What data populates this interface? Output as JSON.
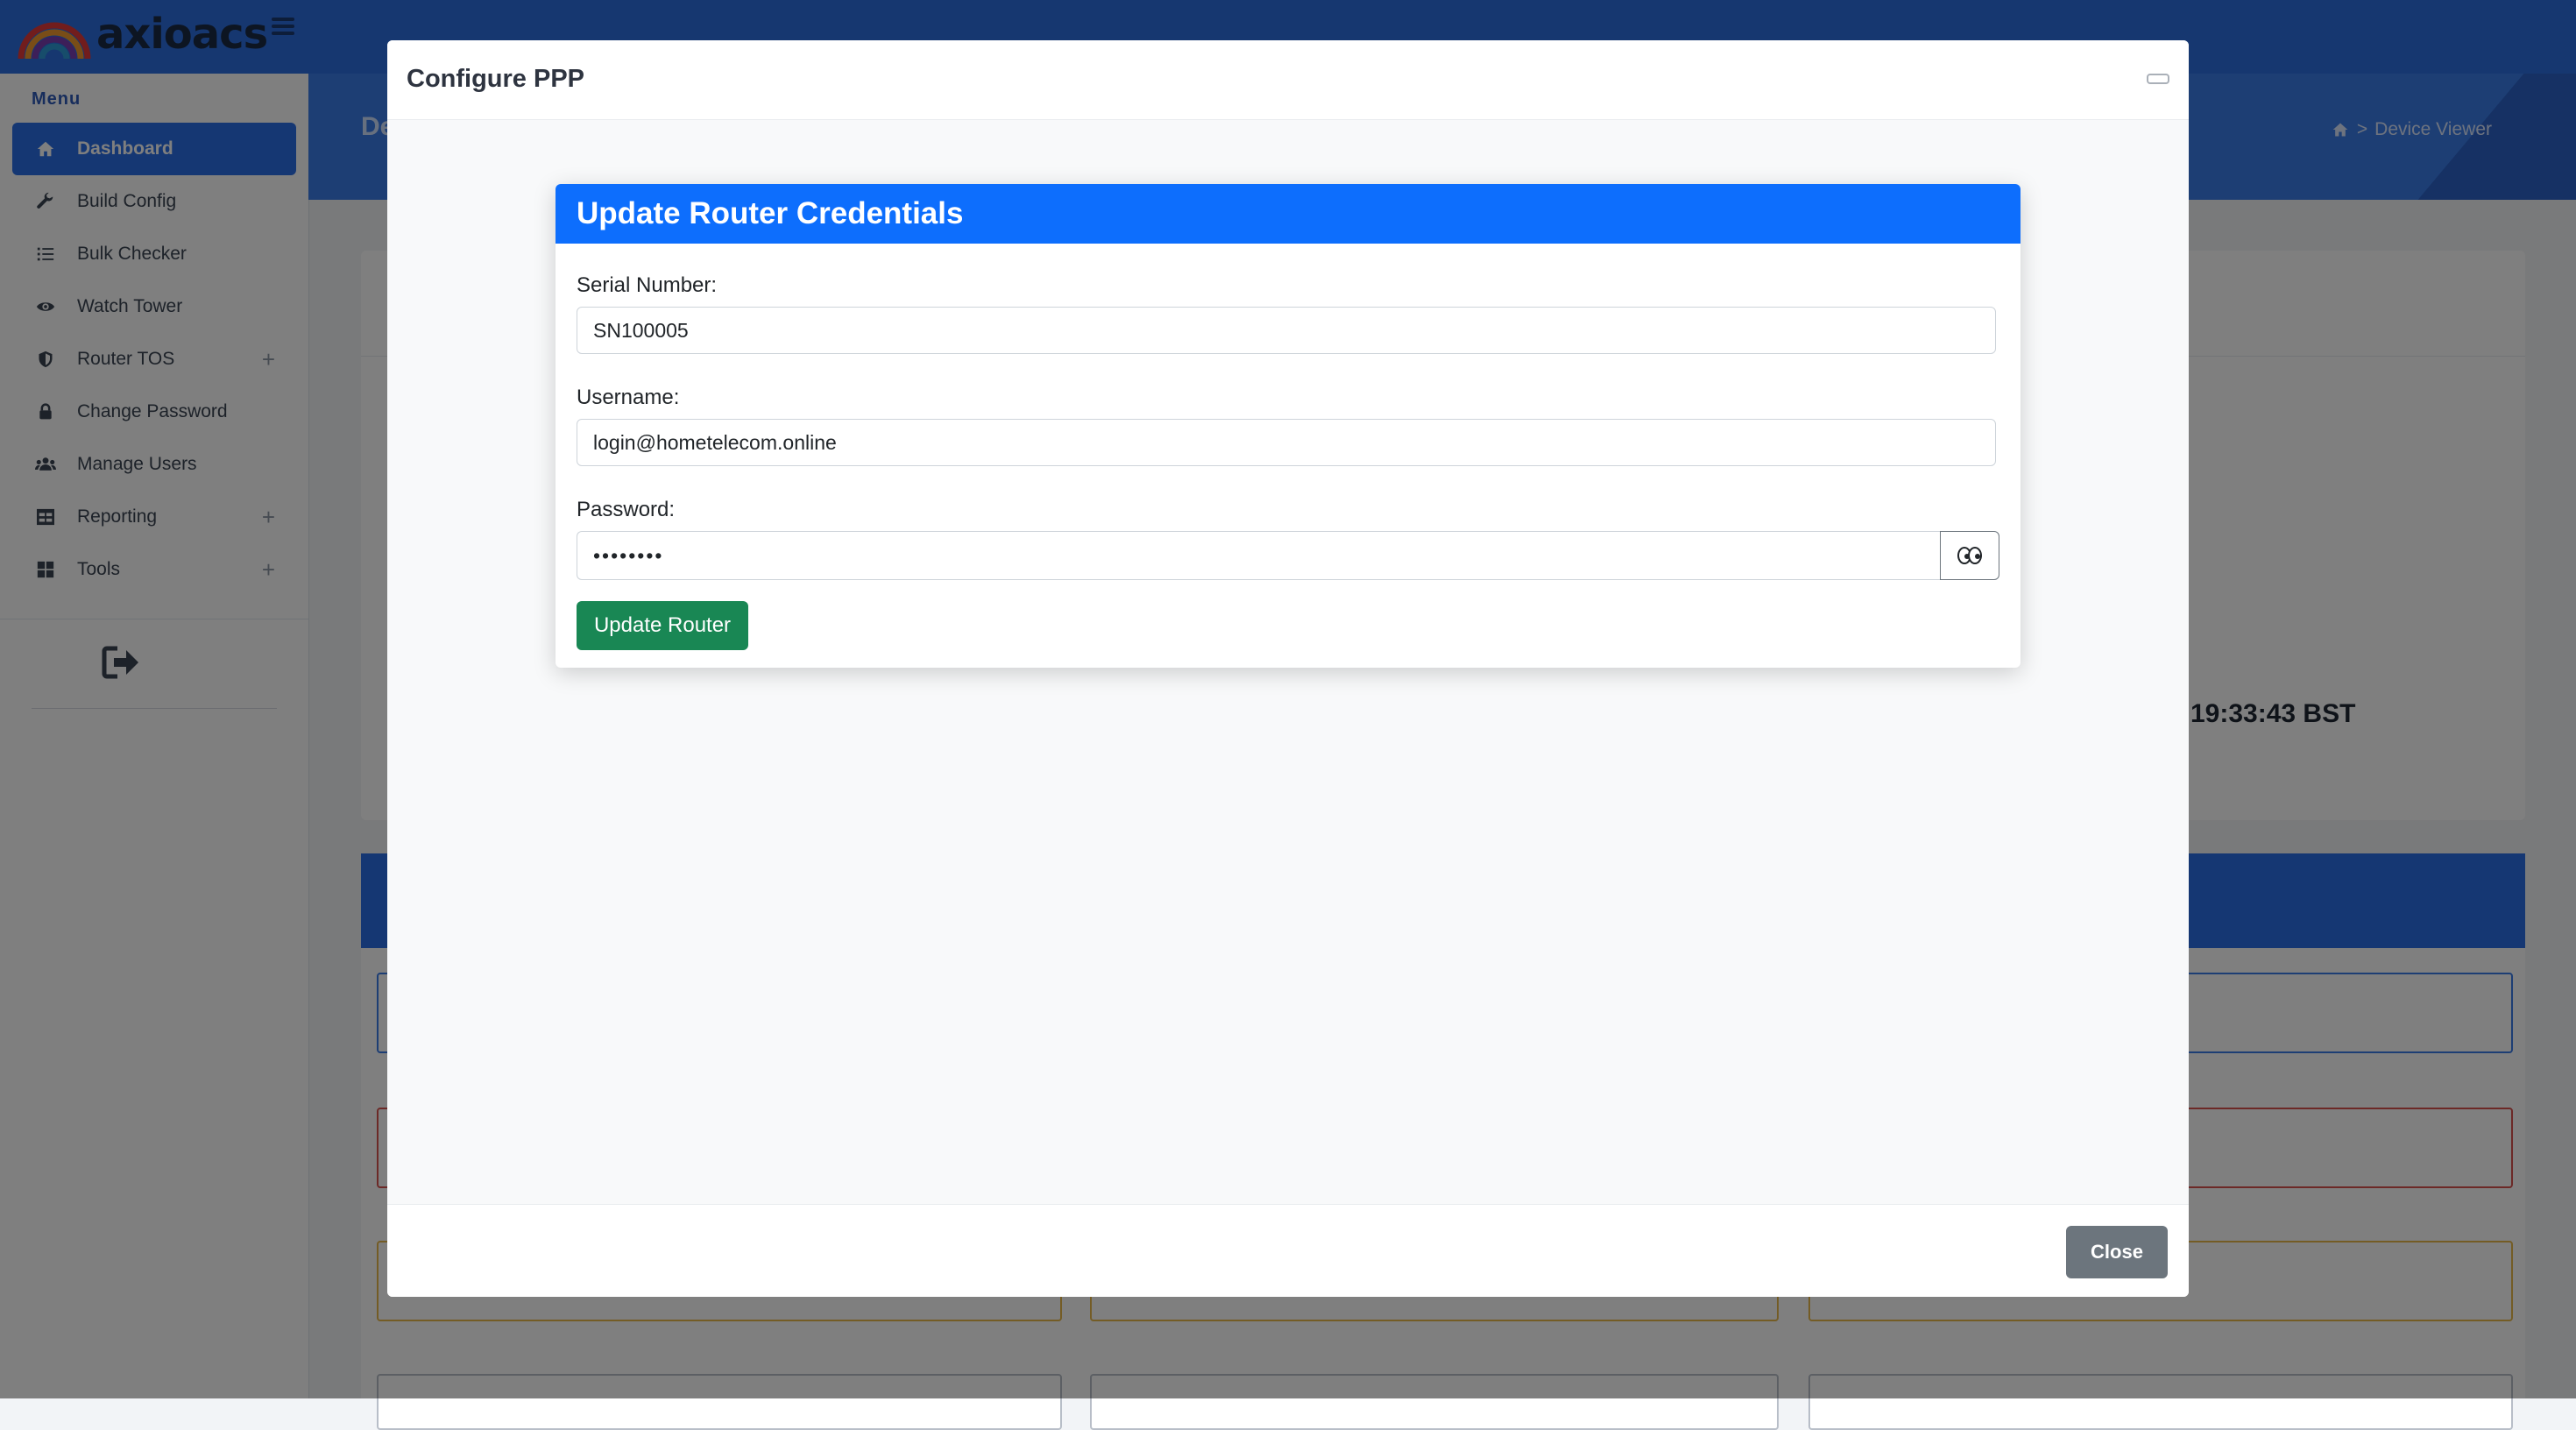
{
  "app": {
    "brand": "axioacs"
  },
  "sidebar": {
    "menu_title": "Menu",
    "items": [
      {
        "label": "Dashboard",
        "icon": "home-icon",
        "active": true
      },
      {
        "label": "Build Config",
        "icon": "wrench-icon"
      },
      {
        "label": "Bulk Checker",
        "icon": "list-icon"
      },
      {
        "label": "Watch Tower",
        "icon": "eye-icon"
      },
      {
        "label": "Router TOS",
        "icon": "shield-icon",
        "expandable": true
      },
      {
        "label": "Change Password",
        "icon": "lock-icon"
      },
      {
        "label": "Manage Users",
        "icon": "users-icon"
      },
      {
        "label": "Reporting",
        "icon": "table-icon",
        "expandable": true
      },
      {
        "label": "Tools",
        "icon": "grid-icon",
        "expandable": true
      }
    ],
    "expand_symbol": "+"
  },
  "page": {
    "title_fragment": "De",
    "breadcrumb_current": "Device Viewer",
    "breadcrumb_separator": ">",
    "clock_fragment": "19:33:43 BST"
  },
  "modal": {
    "title": "Configure PPP",
    "close_label": "Close",
    "form": {
      "heading": "Update Router Credentials",
      "serial_label": "Serial Number:",
      "serial_value": "SN100005",
      "username_label": "Username:",
      "username_value": "login@hometelecom.online",
      "password_label": "Password:",
      "password_mask": "••••••••",
      "submit_label": "Update Router"
    }
  },
  "colors": {
    "primary": "#0d6efd",
    "success": "#198754",
    "secondary": "#6c757d",
    "sidebar_active": "#2b6fe6"
  }
}
